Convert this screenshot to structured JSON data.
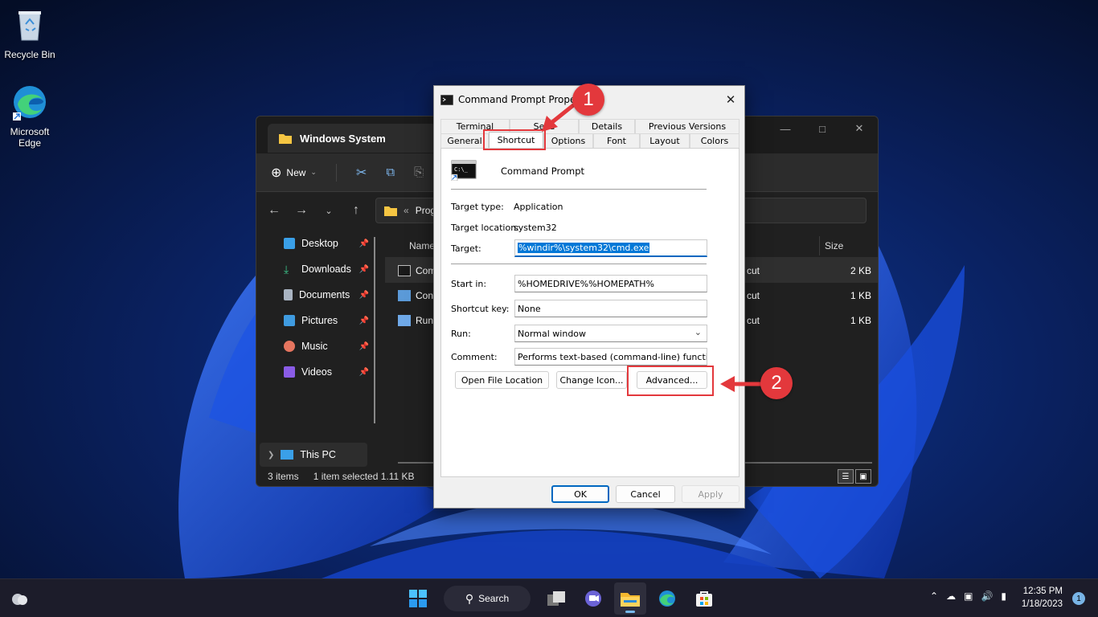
{
  "desktop": {
    "icons": [
      {
        "label": "Recycle Bin"
      },
      {
        "label": "Microsoft Edge"
      }
    ]
  },
  "explorer": {
    "tab_title": "Windows System",
    "new_label": "New",
    "address_overflow": "«",
    "address_path": "Prog...",
    "sidebar": [
      {
        "label": "Desktop",
        "color": "#3aa0e8"
      },
      {
        "label": "Downloads",
        "color": "#3cc48a"
      },
      {
        "label": "Documents",
        "color": "#a9b4c2"
      },
      {
        "label": "Pictures",
        "color": "#3f9be0"
      },
      {
        "label": "Music",
        "color": "#e6755f"
      },
      {
        "label": "Videos",
        "color": "#8a5ce6"
      }
    ],
    "this_pc": "This PC",
    "columns": {
      "name": "Name",
      "size": "Size"
    },
    "rows": [
      {
        "name": "Com",
        "type": "cut",
        "size": "2 KB",
        "selected": true
      },
      {
        "name": "Con",
        "type": "cut",
        "size": "1 KB",
        "selected": false
      },
      {
        "name": "Run",
        "type": "cut",
        "size": "1 KB",
        "selected": false
      }
    ],
    "status": {
      "items": "3 items",
      "selected": "1 item selected  1.11 KB"
    }
  },
  "dialog": {
    "title": "Command Prompt Properti",
    "tabs_row1": [
      "Terminal",
      "Secu",
      "Details",
      "Previous Versions"
    ],
    "tabs_row2": [
      "General",
      "Shortcut",
      "Options",
      "Font",
      "Layout",
      "Colors"
    ],
    "active_tab": "Shortcut",
    "app_name": "Command Prompt",
    "target_type_label": "Target type:",
    "target_type_value": "Application",
    "target_location_label": "Target location:",
    "target_location_value": "system32",
    "target_label": "Target:",
    "target_value": "%windir%\\system32\\cmd.exe",
    "start_in_label": "Start in:",
    "start_in_value": "%HOMEDRIVE%%HOMEPATH%",
    "shortcut_key_label": "Shortcut key:",
    "shortcut_key_value": "None",
    "run_label": "Run:",
    "run_value": "Normal window",
    "comment_label": "Comment:",
    "comment_value": "Performs text-based (command-line) functions.",
    "btn_open_location": "Open File Location",
    "btn_change_icon": "Change Icon...",
    "btn_advanced": "Advanced...",
    "btn_ok": "OK",
    "btn_cancel": "Cancel",
    "btn_apply": "Apply"
  },
  "annotations": {
    "callout_1": "1",
    "callout_2": "2",
    "color": "#e3383c"
  },
  "taskbar": {
    "search_label": "Search",
    "time": "12:35 PM",
    "date": "1/18/2023",
    "notification_count": "1"
  }
}
